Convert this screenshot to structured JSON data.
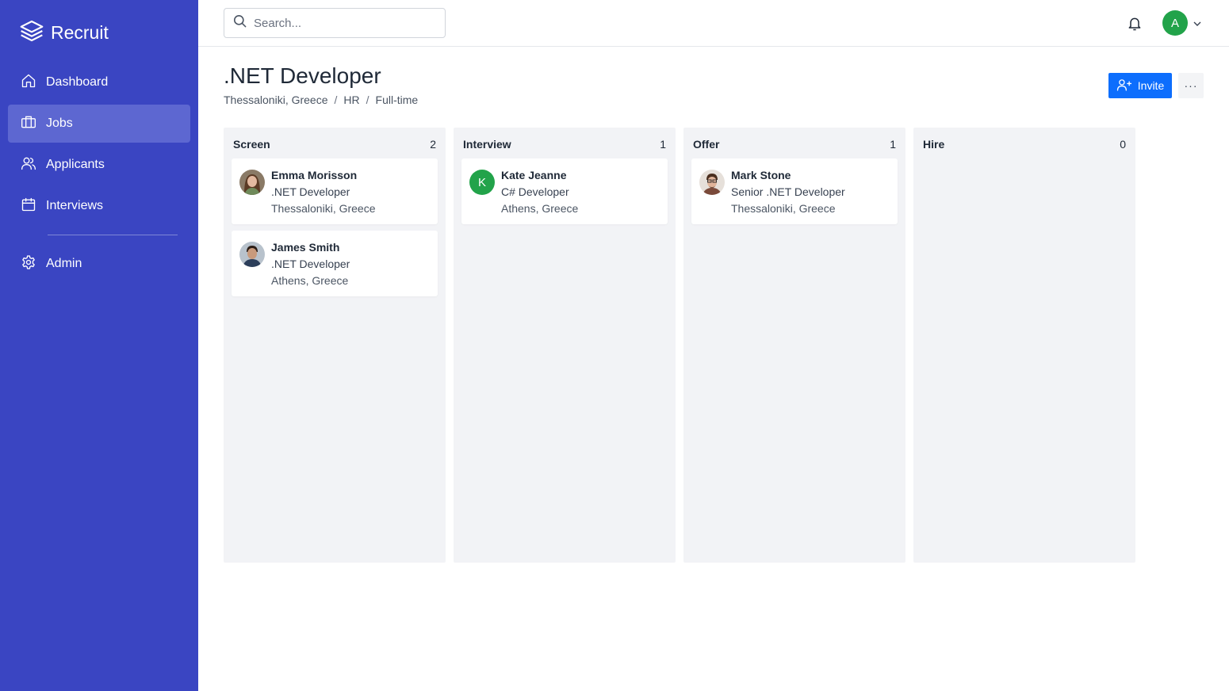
{
  "app": {
    "name": "Recruit"
  },
  "sidebar": {
    "items": [
      {
        "label": "Dashboard",
        "icon": "home-icon"
      },
      {
        "label": "Jobs",
        "icon": "briefcase-icon",
        "active": true
      },
      {
        "label": "Applicants",
        "icon": "users-icon"
      },
      {
        "label": "Interviews",
        "icon": "calendar-icon"
      },
      {
        "label": "Admin",
        "icon": "gear-icon"
      }
    ]
  },
  "topbar": {
    "search_placeholder": "Search...",
    "user_initial": "A"
  },
  "page": {
    "title": ".NET Developer",
    "breadcrumb": [
      "Thessaloniki, Greece",
      "HR",
      "Full-time"
    ],
    "invite_label": "Invite",
    "more_label": "···"
  },
  "board": {
    "columns": [
      {
        "title": "Screen",
        "count": "2",
        "cards": [
          {
            "name": "Emma Morisson",
            "role": ".NET Developer",
            "location": "Thessaloniki, Greece",
            "avatar": "photo"
          },
          {
            "name": "James Smith",
            "role": ".NET Developer",
            "location": "Athens, Greece",
            "avatar": "photo"
          }
        ]
      },
      {
        "title": "Interview",
        "count": "1",
        "cards": [
          {
            "name": "Kate Jeanne",
            "role": "C# Developer",
            "location": "Athens, Greece",
            "avatar_letter": "K"
          }
        ]
      },
      {
        "title": "Offer",
        "count": "1",
        "cards": [
          {
            "name": "Mark Stone",
            "role": "Senior .NET Developer",
            "location": "Thessaloniki, Greece",
            "avatar": "photo"
          }
        ]
      },
      {
        "title": "Hire",
        "count": "0",
        "cards": []
      }
    ]
  },
  "colors": {
    "sidebar_bg": "#3a45c2",
    "sidebar_active": "#5d67d1",
    "primary_button": "#0d6efd",
    "column_bg": "#f2f3f6",
    "avatar_green": "#22a34a"
  }
}
